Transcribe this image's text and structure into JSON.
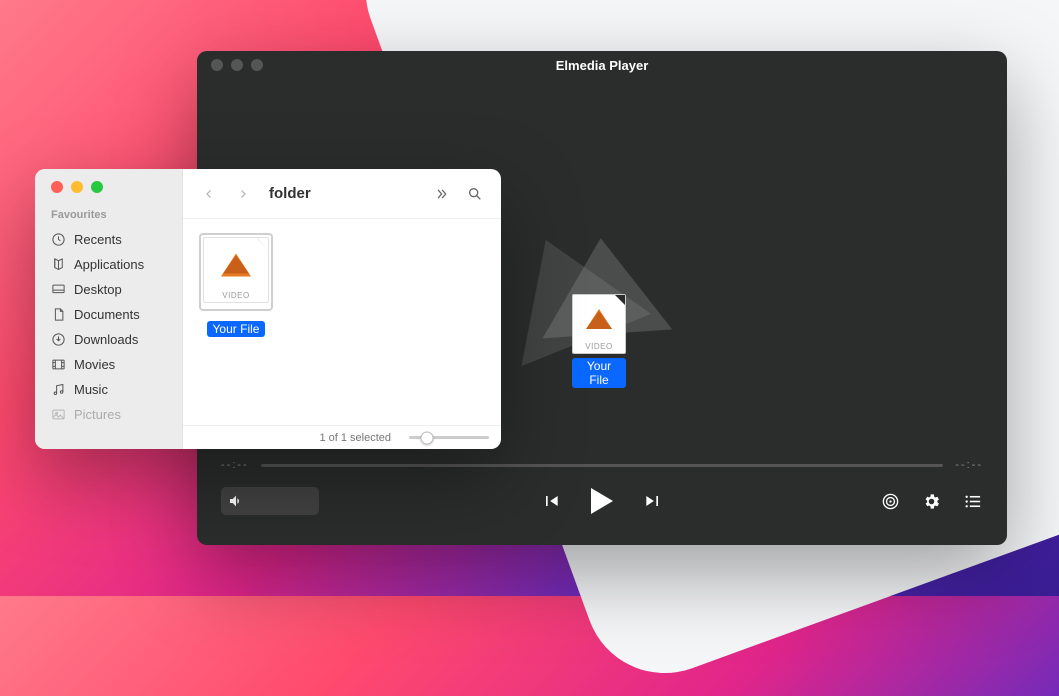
{
  "player": {
    "title": "Elmedia Player",
    "time_left": "--:--",
    "time_right": "--:--",
    "drag_file": {
      "thumb_label": "VIDEO",
      "name": "Your File"
    }
  },
  "finder": {
    "folder_name": "folder",
    "favourites_header": "Favourites",
    "sidebar": {
      "items": [
        {
          "icon": "clock",
          "label": "Recents"
        },
        {
          "icon": "apps",
          "label": "Applications"
        },
        {
          "icon": "desktop",
          "label": "Desktop"
        },
        {
          "icon": "doc",
          "label": "Documents"
        },
        {
          "icon": "download",
          "label": "Downloads"
        },
        {
          "icon": "movies",
          "label": "Movies"
        },
        {
          "icon": "music",
          "label": "Music"
        },
        {
          "icon": "pictures",
          "label": "Pictures"
        }
      ]
    },
    "file": {
      "thumb_label": "VIDEO",
      "name": "Your File"
    },
    "status_text": "1 of 1 selected"
  }
}
